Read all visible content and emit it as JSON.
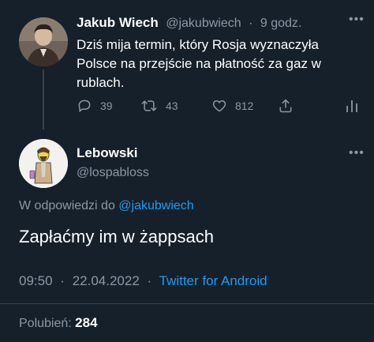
{
  "parent_tweet": {
    "display_name": "Jakub Wiech",
    "handle": "@jakubwiech",
    "separator": "·",
    "time_ago": "9 godz.",
    "text": "Dziś mija termin, który Rosja wyznaczyła Polsce na przejście na płatność za gaz w rublach.",
    "more_icon": "•••",
    "actions": {
      "reply_count": "39",
      "retweet_count": "43",
      "like_count": "812"
    },
    "icons": {
      "reply": "reply-icon",
      "retweet": "retweet-icon",
      "like": "heart-icon",
      "share": "share-icon",
      "stats": "stats-icon"
    }
  },
  "reply_tweet": {
    "display_name": "Lebowski",
    "handle": "@lospabloss",
    "more_icon": "•••",
    "replying_prefix": "W odpowiedzi do",
    "replying_to": "@jakubwiech",
    "text": "Zapłaćmy im w żappsach",
    "time": "09:50",
    "separator": "·",
    "date": "22.04.2022",
    "source": "Twitter for Android",
    "likes_label": "Polubień:",
    "likes_count": "284"
  },
  "colors": {
    "background": "#15202b",
    "accent": "#1d9bf0",
    "secondary_text": "#8b98a5",
    "divider": "#38444d"
  }
}
